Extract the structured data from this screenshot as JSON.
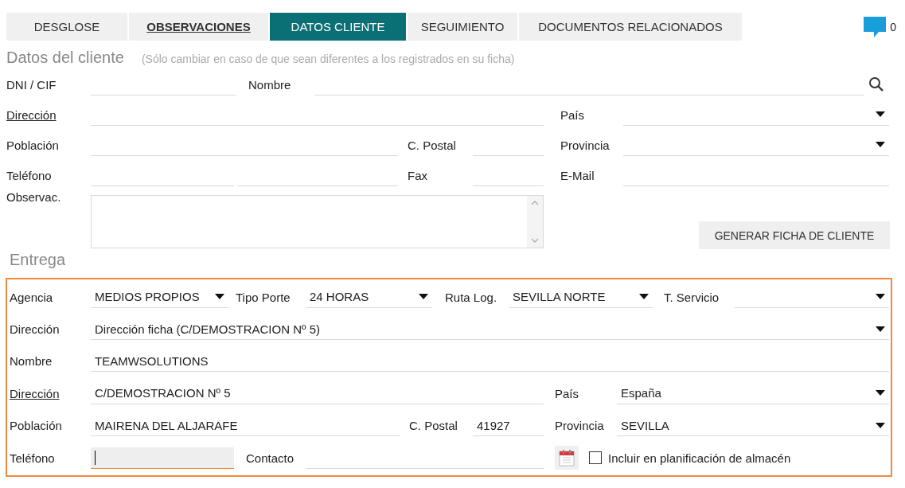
{
  "tabs": [
    {
      "label": "DESGLOSE",
      "selected": false,
      "marked": false
    },
    {
      "label": "OBSERVACIONES",
      "selected": false,
      "marked": true
    },
    {
      "label": "DATOS CLIENTE",
      "selected": true,
      "marked": false
    },
    {
      "label": "SEGUIMIENTO",
      "selected": false,
      "marked": false
    },
    {
      "label": "DOCUMENTOS RELACIONADOS",
      "selected": false,
      "marked": false
    }
  ],
  "comments": {
    "count": "0"
  },
  "customer": {
    "title": "Datos del cliente",
    "note": "(Sólo cambiar en caso de que sean diferentes a los registrados en su ficha)",
    "rows": [
      {
        "fields": [
          {
            "kind": "text",
            "label": "DNI / CIF",
            "link": false
          },
          {
            "kind": "search",
            "label": "Nombre",
            "link": false
          }
        ]
      },
      {
        "fields": [
          {
            "kind": "text",
            "label": "Dirección",
            "link": true
          },
          {
            "kind": "select",
            "label": "País",
            "link": false
          }
        ]
      },
      {
        "fields": [
          {
            "kind": "text",
            "label": "Población",
            "link": false
          },
          {
            "kind": "text",
            "label": "C. Postal",
            "link": false
          },
          {
            "kind": "select",
            "label": "Provincia",
            "link": false
          }
        ]
      },
      {
        "fields": [
          {
            "kind": "split",
            "label": "Teléfono",
            "link": false
          },
          {
            "kind": "text",
            "label": "Fax",
            "link": false
          },
          {
            "kind": "text",
            "label": "E-Mail",
            "link": false
          }
        ]
      },
      {
        "fields": [
          {
            "kind": "textarea",
            "label": "Observac.",
            "link": false
          }
        ]
      }
    ],
    "button": "GENERAR FICHA DE CLIENTE"
  },
  "delivery": {
    "title": "Entrega",
    "rows": [
      {
        "fields": [
          {
            "kind": "select",
            "label": "Agencia",
            "link": false,
            "value": "MEDIOS PROPIOS"
          },
          {
            "kind": "select",
            "label": "Tipo Porte",
            "link": false,
            "value": "24 HORAS"
          },
          {
            "kind": "select",
            "label": "Ruta Log.",
            "link": false,
            "value": "SEVILLA NORTE"
          },
          {
            "kind": "select",
            "label": "T. Servicio",
            "link": false
          }
        ]
      },
      {
        "fields": [
          {
            "kind": "select",
            "label": "Dirección",
            "link": false,
            "value": "Dirección ficha (C/DEMOSTRACION Nº 5)"
          }
        ]
      },
      {
        "fields": [
          {
            "kind": "text",
            "label": "Nombre",
            "link": false,
            "value": "TEAMWSOLUTIONS"
          }
        ]
      },
      {
        "fields": [
          {
            "kind": "text",
            "label": "Dirección",
            "link": true,
            "value": "C/DEMOSTRACION Nº 5"
          },
          {
            "kind": "select",
            "label": "País",
            "link": false,
            "value": "España"
          }
        ]
      },
      {
        "fields": [
          {
            "kind": "text",
            "label": "Población",
            "link": false,
            "value": "MAIRENA DEL ALJARAFE"
          },
          {
            "kind": "text",
            "label": "C. Postal",
            "link": false,
            "value": "41927"
          },
          {
            "kind": "select",
            "label": "Provincia",
            "link": false,
            "value": "SEVILLA"
          }
        ]
      },
      {
        "fields": [
          {
            "kind": "text",
            "label": "Teléfono",
            "link": false,
            "focused": true
          },
          {
            "kind": "text",
            "label": "Contacto",
            "link": false,
            "focused": false
          }
        ]
      }
    ],
    "checkbox": {
      "label": "Incluir en planificación de almacén",
      "checked": false
    }
  }
}
